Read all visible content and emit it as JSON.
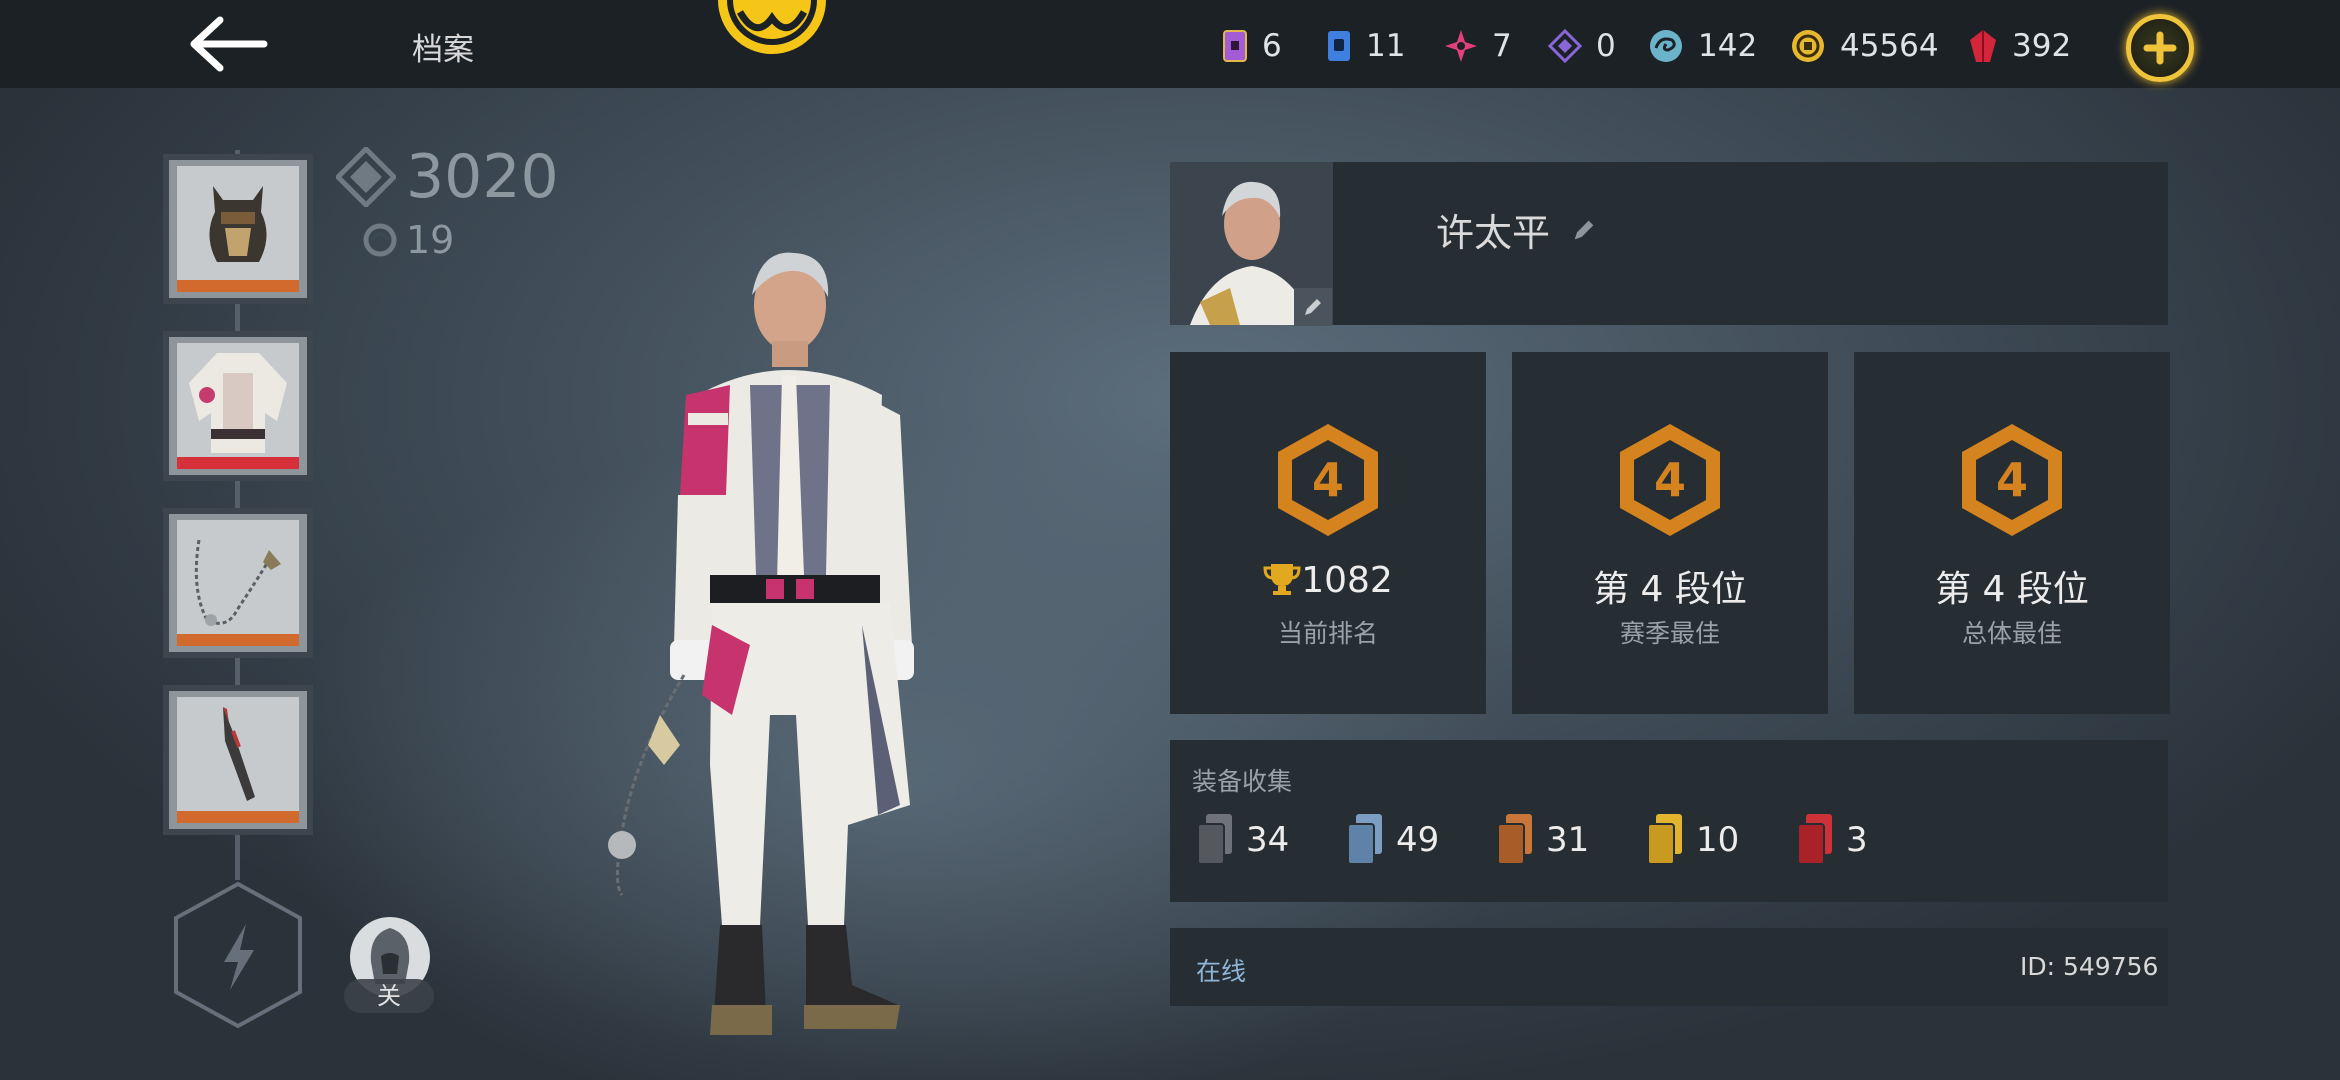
{
  "header": {
    "title": "档案",
    "resources": [
      {
        "icon": "purple-card-icon",
        "value": "6",
        "color": "#a45bd6"
      },
      {
        "icon": "blue-card-icon",
        "value": "11",
        "color": "#3f7fe0"
      },
      {
        "icon": "pink-shuriken-icon",
        "value": "7",
        "color": "#e2407d"
      },
      {
        "icon": "violet-diamond-icon",
        "value": "0",
        "color": "#8a67d8"
      },
      {
        "icon": "swirl-icon",
        "value": "142",
        "color": "#6bb3c9"
      },
      {
        "icon": "gold-coin-icon",
        "value": "45564",
        "color": "#e6b82f"
      },
      {
        "icon": "ruby-gem-icon",
        "value": "392",
        "color": "#d4263b"
      }
    ]
  },
  "left": {
    "power_value": "3020",
    "sub_value": "19",
    "slots": [
      {
        "name": "helmet",
        "bar_color": "#d36a2d"
      },
      {
        "name": "armor",
        "bar_color": "#d6303a"
      },
      {
        "name": "chain-weapon",
        "bar_color": "#d36a2d"
      },
      {
        "name": "blade",
        "bar_color": "#d36a2d"
      }
    ],
    "toggle_label": "关"
  },
  "profile": {
    "player_name": "许太平"
  },
  "ranks": [
    {
      "badge": "4",
      "value": "1082",
      "label": "当前排名",
      "has_trophy": true
    },
    {
      "badge": "4",
      "value": "第 4 段位",
      "label": "赛季最佳",
      "has_trophy": false
    },
    {
      "badge": "4",
      "value": "第 4 段位",
      "label": "总体最佳",
      "has_trophy": false
    }
  ],
  "collection": {
    "title": "装备收集",
    "items": [
      {
        "icon": "gray-card-icon",
        "value": "34",
        "color": "#6f7377"
      },
      {
        "icon": "blue-card-icon",
        "value": "49",
        "color": "#7c9ec2"
      },
      {
        "icon": "orange-card-icon",
        "value": "31",
        "color": "#c8763a"
      },
      {
        "icon": "gold-card-icon",
        "value": "10",
        "color": "#e3b52f"
      },
      {
        "icon": "red-card-icon",
        "value": "3",
        "color": "#cc3238"
      }
    ]
  },
  "status": {
    "online": "在线",
    "id": "ID: 549756"
  },
  "colors": {
    "accent": "#f0c43a",
    "rank_orange": "#d4831f",
    "panel": "#262d33"
  }
}
